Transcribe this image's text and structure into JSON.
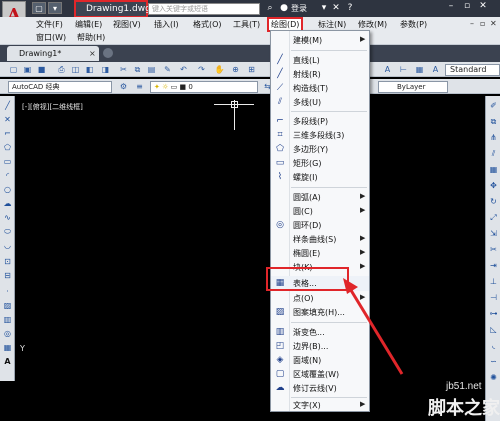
{
  "title_bar": {
    "doc_title": "Drawing1.dwg",
    "search_placeholder": "键入关键字或短语",
    "login_label": "登录"
  },
  "menu_bar": {
    "items": [
      "文件(F)",
      "编辑(E)",
      "视图(V)",
      "插入(I)",
      "格式(O)",
      "工具(T)",
      "绘图(D)",
      "标注(N)",
      "修改(M)",
      "参数(P)",
      "窗口(W)",
      "帮助(H)"
    ],
    "active": "绘图(D)"
  },
  "tabs": {
    "active_tab": "Drawing1*",
    "close_glyph": "×"
  },
  "toolbar": {
    "workspace": "AutoCAD 经典",
    "text_style": "Standard",
    "linetype": "ByLayer",
    "layer_value": "0"
  },
  "canvas": {
    "viewport_label": "[-][俯视][二维线框]",
    "ucs_y": "Y"
  },
  "draw_menu": {
    "items": [
      {
        "label": "建模(M)",
        "icon": "",
        "submenu": true
      },
      {
        "label": "直线(L)",
        "icon": "line-icon",
        "submenu": false
      },
      {
        "label": "射线(R)",
        "icon": "ray-icon",
        "submenu": false
      },
      {
        "label": "构造线(T)",
        "icon": "xline-icon",
        "submenu": false
      },
      {
        "label": "多线(U)",
        "icon": "mline-icon",
        "submenu": false
      },
      {
        "label": "多段线(P)",
        "icon": "polyline-icon",
        "submenu": false
      },
      {
        "label": "三维多段线(3)",
        "icon": "3dpoly-icon",
        "submenu": false
      },
      {
        "label": "多边形(Y)",
        "icon": "polygon-icon",
        "submenu": false
      },
      {
        "label": "矩形(G)",
        "icon": "rectangle-icon",
        "submenu": false
      },
      {
        "label": "螺旋(I)",
        "icon": "helix-icon",
        "submenu": false
      },
      {
        "label": "圆弧(A)",
        "icon": "",
        "submenu": true
      },
      {
        "label": "圆(C)",
        "icon": "",
        "submenu": true
      },
      {
        "label": "圆环(D)",
        "icon": "donut-icon",
        "submenu": false
      },
      {
        "label": "样条曲线(S)",
        "icon": "",
        "submenu": true
      },
      {
        "label": "椭圆(E)",
        "icon": "",
        "submenu": true
      },
      {
        "label": "块(K)",
        "icon": "",
        "submenu": true
      },
      {
        "label": "表格...",
        "icon": "table-icon",
        "submenu": false
      },
      {
        "label": "点(O)",
        "icon": "",
        "submenu": true
      },
      {
        "label": "图案填充(H)...",
        "icon": "hatch-icon",
        "submenu": false
      },
      {
        "label": "渐变色...",
        "icon": "gradient-icon",
        "submenu": false
      },
      {
        "label": "边界(B)...",
        "icon": "boundary-icon",
        "submenu": false
      },
      {
        "label": "面域(N)",
        "icon": "region-icon",
        "submenu": false
      },
      {
        "label": "区域覆盖(W)",
        "icon": "wipeout-icon",
        "submenu": false
      },
      {
        "label": "修订云线(V)",
        "icon": "revcloud-icon",
        "submenu": false
      },
      {
        "label": "文字(X)",
        "icon": "",
        "submenu": true
      }
    ],
    "highlighted": "表格..."
  },
  "watermark": {
    "url": "jb51.net",
    "brand": "脚本之家"
  },
  "colors": {
    "highlight_red": "#e0262a",
    "titlebar": "#2e3440",
    "menubar": "#e7eaee",
    "canvas": "#000000"
  }
}
